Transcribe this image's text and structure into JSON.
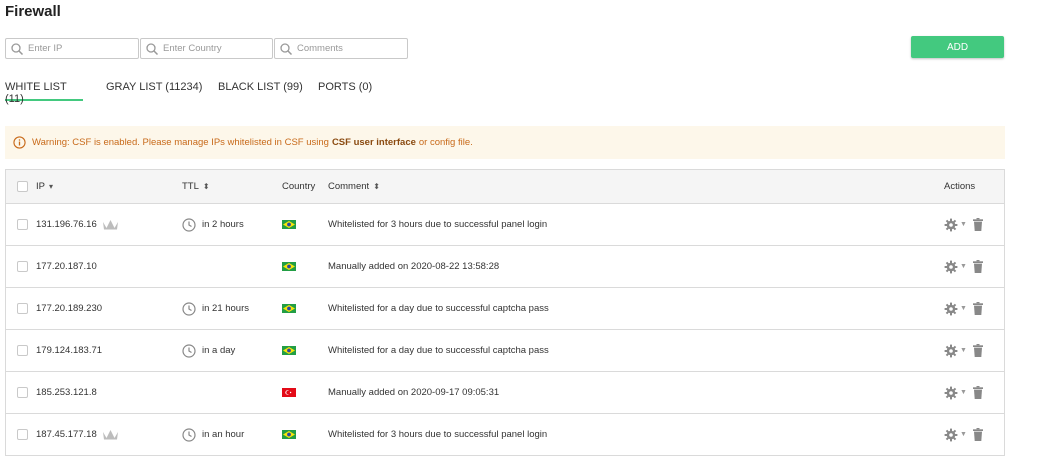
{
  "page": {
    "title": "Firewall"
  },
  "filters": {
    "ip_placeholder": "Enter IP",
    "country_placeholder": "Enter Country",
    "comments_placeholder": "Comments",
    "icon": "search-icon"
  },
  "add_button": {
    "label": "ADD",
    "color": "#43c97f"
  },
  "tabs": [
    {
      "label": "WHITE LIST (11)",
      "active": true
    },
    {
      "label": "GRAY LIST (11234)",
      "active": false
    },
    {
      "label": "BLACK LIST (99)",
      "active": false
    },
    {
      "label": "PORTS (0)",
      "active": false
    }
  ],
  "warning": {
    "icon": "info-circle-icon",
    "text_before": "Warning: CSF is enabled. Please manage IPs whitelisted in CSF using",
    "link": "CSF user interface",
    "text_after": "or config file.",
    "bg_color": "#fdf7ea",
    "text_color": "#c86a1a"
  },
  "table": {
    "columns": {
      "ip": "IP",
      "ttl": "TTL",
      "country": "Country",
      "comment": "Comment",
      "actions": "Actions"
    },
    "rows": [
      {
        "ip": "131.196.76.16",
        "crown": true,
        "ttl": "in 2 hours",
        "flag": "br",
        "comment": "Whitelisted for 3 hours due to successful panel login"
      },
      {
        "ip": "177.20.187.10",
        "crown": false,
        "ttl": "",
        "flag": "br",
        "comment": "Manually added on 2020-08-22 13:58:28"
      },
      {
        "ip": "177.20.189.230",
        "crown": false,
        "ttl": "in 21 hours",
        "flag": "br",
        "comment": "Whitelisted for a day due to successful captcha pass"
      },
      {
        "ip": "179.124.183.71",
        "crown": false,
        "ttl": "in a day",
        "flag": "br",
        "comment": "Whitelisted for a day due to successful captcha pass"
      },
      {
        "ip": "185.253.121.8",
        "crown": false,
        "ttl": "",
        "flag": "tr",
        "comment": "Manually added on 2020-09-17 09:05:31"
      },
      {
        "ip": "187.45.177.18",
        "crown": true,
        "ttl": "in an hour",
        "flag": "br",
        "comment": "Whitelisted for 3 hours due to successful panel login"
      }
    ]
  },
  "colors": {
    "accent": "#43c97f",
    "border": "#dadada",
    "header_bg": "#f5f5f5"
  }
}
